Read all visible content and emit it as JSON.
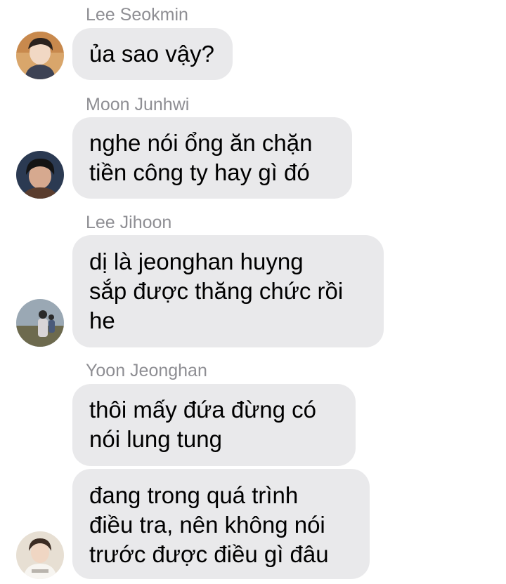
{
  "messages": [
    {
      "sender": "Lee Seokmin",
      "avatar_icon": "avatar-lee-seokmin",
      "bubbles": [
        {
          "lines": [
            "ủa sao vậy?"
          ]
        }
      ]
    },
    {
      "sender": "Moon Junhwi",
      "avatar_icon": "avatar-moon-junhwi",
      "bubbles": [
        {
          "lines": [
            "nghe nói ổng ăn chặn",
            "tiền công ty hay gì đó"
          ]
        }
      ]
    },
    {
      "sender": "Lee Jihoon",
      "avatar_icon": "avatar-lee-jihoon",
      "bubbles": [
        {
          "lines": [
            "dị là jeonghan huyng",
            "sắp được thăng chức rồi",
            "he"
          ]
        }
      ]
    },
    {
      "sender": "Yoon Jeonghan",
      "avatar_icon": "avatar-yoon-jeonghan",
      "bubbles": [
        {
          "lines": [
            "thôi mấy đứa đừng có",
            "nói lung tung"
          ]
        },
        {
          "lines": [
            "đang trong quá trình",
            "điều tra, nên không nói",
            "trước được điều gì đâu"
          ]
        }
      ]
    }
  ],
  "colors": {
    "bubble": "#e9e9eb",
    "sender": "#8e8e93",
    "text": "#000000",
    "background": "#ffffff"
  }
}
